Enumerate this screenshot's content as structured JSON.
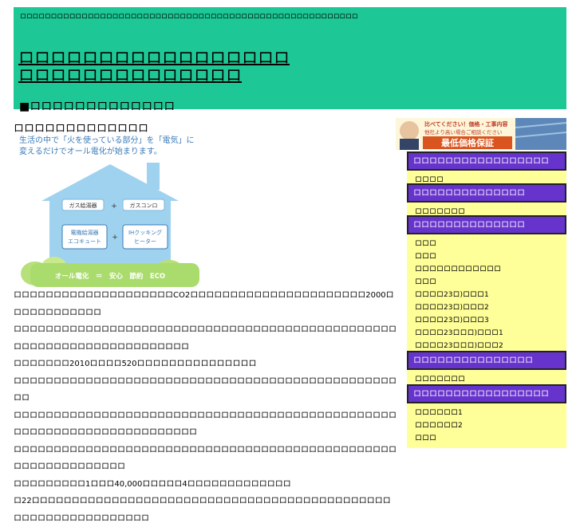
{
  "header": {
    "tagline": "ロロロロロロロロロロロロロロロロロロロロロロロロロロロロロロロロロロロロロロロロロロロロロロロロロロロロロロロ",
    "title_line1": "ロロロロロロロロロロロロロロロロロ",
    "title_line2": "ロロロロロロロロロロロロロロ",
    "subtitle": "■ロロロロロロロロロロロロロ"
  },
  "main": {
    "heading": "ロロロロロロロロロロロロロ",
    "illustration": {
      "caption_line1": "生活の中で「火を使っている部分」を「電気」に",
      "caption_line2": "変えるだけでオール電化が始まります。",
      "gas_heater": "ガス給湯器",
      "gas_stove": "ガスコンロ",
      "eco_cute_1": "電機給湯器",
      "eco_cute_2": "エコキュート",
      "ih_1": "IHクッキング",
      "ih_2": "ヒーター",
      "plus": "+",
      "banner": "オール電化　＝　安心　節約　ECO"
    },
    "paragraphs": [
      "ロロロロロロロロロロロロロロロロロロロロCO2ロロロロロロロロロロロロロロロロロロロロロロ2000ロロロロロロロロロロロロ",
      "ロロロロロロロロロロロロロロロロロロロロロロロロロロロロロロロロロロロロロロロロロロロロロロロロロロロロロロロロロロロロロロロロロロロロロロ",
      "ロロロロロロロ2010ロロロロ520ロロロロロロロロロロロロロロロ",
      "ロロロロロロロロロロロロロロロロロロロロロロロロロロロロロロロロロロロロロロロロロロロロロロロロロロ",
      "ロロロロロロロロロロロロロロロロロロロロロロロロロロロロロロロロロロロロロロロロロロロロロロロロロロロロロロロロロロロロロロロロロロロロロロロ",
      "ロロロロロロロロロロロロロロロロロロロロロロロロロロロロロロロロロロロロロロロロロロロロロロロロロロロロロロロロロロロロロロ",
      "ロロロロロロロロロ1ロロロ40,000ロロロロロ4ロロロロロロロロロロロロロ",
      "ロ22ロロロロロロロロロロロロロロロロロロロロロロロロロロロロロロロロロロロロロロロロロロロロロロロロロロロロロロロロロロロロロロ"
    ]
  },
  "sidebar": {
    "banner": {
      "top_text": "比べてください！価格・工事内容",
      "mid_text": "他社より高い場合ご相談ください",
      "bottom_text": "最低価格保証"
    },
    "widgets": [
      {
        "title": "ロロロロロロロロロロロロロロロロロ",
        "items": [
          "ロロロロ"
        ]
      },
      {
        "title": "ロロロロロロロロロロロロロロ",
        "items": [
          "ロロロロロロロ"
        ]
      },
      {
        "title": "ロロロロロロロロロロロロロロ",
        "items": [
          "ロロロ",
          "ロロロ",
          "ロロロロロロロロロロロロ",
          "ロロロ",
          "ロロロロ23ロ)ロロロ1",
          "ロロロロ23ロ)ロロロ2",
          "ロロロロ23ロ)ロロロ3",
          "ロロロロ23ロロロ)ロロロ1",
          "ロロロロ23ロロロ)ロロロ2"
        ]
      },
      {
        "title": "ロロロロロロロロロロロロロロロ",
        "items": [
          "ロロロロロロロ"
        ]
      },
      {
        "title": "ロロロロロロロロロロロロロロロロロ",
        "items": [
          "ロロロロロロ1",
          "ロロロロロロ2",
          "ロロロ"
        ]
      }
    ]
  }
}
